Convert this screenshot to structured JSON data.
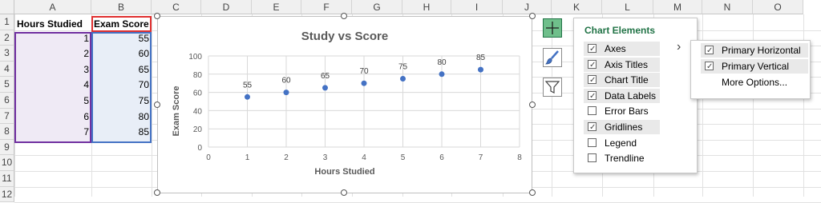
{
  "columns": [
    "A",
    "B",
    "C",
    "D",
    "E",
    "F",
    "G",
    "H",
    "I",
    "J",
    "K",
    "L",
    "M",
    "N",
    "O"
  ],
  "rows": [
    "1",
    "2",
    "3",
    "4",
    "5",
    "6",
    "7",
    "8",
    "9",
    "10",
    "11",
    "12"
  ],
  "table": {
    "headers": [
      "Hours Studied",
      "Exam Score"
    ],
    "hours": [
      "1",
      "2",
      "3",
      "4",
      "5",
      "6",
      "7"
    ],
    "scores": [
      "55",
      "60",
      "65",
      "70",
      "75",
      "80",
      "85"
    ]
  },
  "chart_data": {
    "type": "scatter",
    "title": "Study vs Score",
    "xlabel": "Hours Studied",
    "ylabel": "Exam Score",
    "x": [
      1,
      2,
      3,
      4,
      5,
      6,
      7
    ],
    "y": [
      55,
      60,
      65,
      70,
      75,
      80,
      85
    ],
    "data_labels": [
      "55",
      "60",
      "65",
      "70",
      "75",
      "80",
      "85"
    ],
    "xlim": [
      0,
      8
    ],
    "ylim": [
      0,
      100
    ],
    "xticks": [
      "0",
      "1",
      "2",
      "3",
      "4",
      "5",
      "6",
      "7",
      "8"
    ],
    "yticks": [
      "0",
      "20",
      "40",
      "60",
      "80",
      "100"
    ],
    "grid": true,
    "marker_color": "#4472c4"
  },
  "side_buttons": {
    "elements_icon": "plus-icon",
    "styles_icon": "brush-icon",
    "filters_icon": "funnel-icon"
  },
  "chart_elements_panel": {
    "title": "Chart Elements",
    "items": [
      {
        "label": "Axes",
        "checked": true
      },
      {
        "label": "Axis Titles",
        "checked": true
      },
      {
        "label": "Chart Title",
        "checked": true
      },
      {
        "label": "Data Labels",
        "checked": true
      },
      {
        "label": "Error Bars",
        "checked": false
      },
      {
        "label": "Gridlines",
        "checked": true
      },
      {
        "label": "Legend",
        "checked": false
      },
      {
        "label": "Trendline",
        "checked": false
      }
    ],
    "arrow": "›"
  },
  "axes_submenu": {
    "items": [
      {
        "label": "Primary Horizontal",
        "checked": true
      },
      {
        "label": "Primary Vertical",
        "checked": true
      }
    ],
    "more": "More Options..."
  },
  "colors": {
    "accent_green": "#217346",
    "series": "#4472c4",
    "range_purple": "#7030a0",
    "range_blue": "#4472c4",
    "range_red": "#e03030"
  }
}
